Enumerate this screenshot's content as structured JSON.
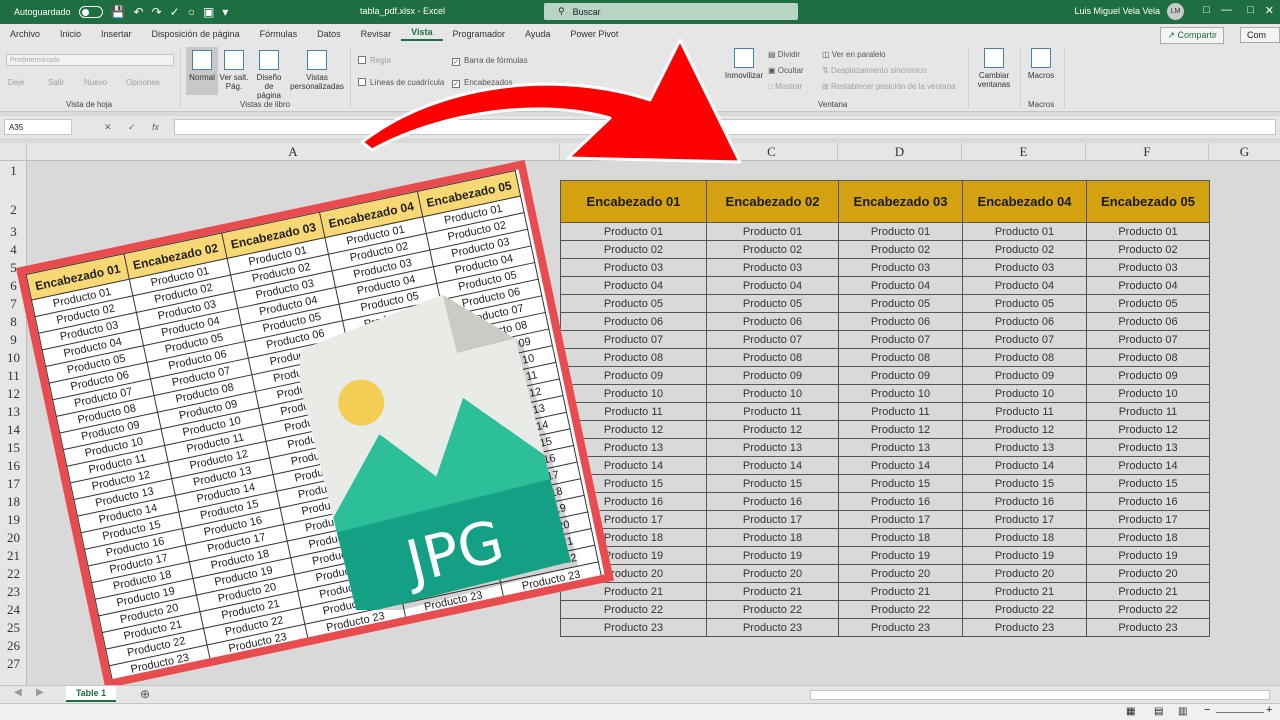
{
  "titlebar": {
    "autosave_label": "Autoguardado",
    "filename": "tabla_pdf.xlsx",
    "app": "Excel",
    "search_placeholder": "Buscar",
    "user_name": "Luis Miguel Vela Vela",
    "user_initials": "LM"
  },
  "menu": {
    "tabs": [
      "Archivo",
      "Inicio",
      "Insertar",
      "Disposición de página",
      "Fórmulas",
      "Datos",
      "Revisar",
      "Vista",
      "Programador",
      "Ayuda",
      "Power Pivot"
    ],
    "active_tab": "Vista",
    "share_label": "Compartir",
    "comments_label": "Com"
  },
  "ribbon": {
    "view_combo": "Predeterminado",
    "sheet_view_buttons": [
      "Deje",
      "Salir",
      "Nuevo",
      "Opciones"
    ],
    "group_sheet_view": "Vista de hoja",
    "btn_normal": "Normal",
    "btn_page_break": "Ver salt. Pág.",
    "btn_page_layout": "Diseño de página",
    "btn_custom_views": "Vistas personalizadas",
    "group_workbook_views": "Vistas de libro",
    "chk_ruler": "Regla",
    "chk_formula_bar": "Barra de fórmulas",
    "chk_gridlines": "Líneas de cuadrícula",
    "chk_headings": "Encabezados",
    "btn_freeze": "Inmovilizar",
    "btn_split": "Dividir",
    "btn_hide": "Ocultar",
    "btn_show": "Mostrar",
    "btn_side_by_side": "Ver en paralelo",
    "btn_sync_scroll": "Desplazamiento sincrónico",
    "btn_reset_position": "Restablecer posición de la ventana",
    "btn_switch_windows": "Cambiar ventanas",
    "group_window": "Ventana",
    "btn_macros": "Macros",
    "group_macros": "Macros"
  },
  "formula_bar": {
    "name_box": "A35",
    "fx": "fx"
  },
  "columns": [
    "A",
    "C",
    "D",
    "E",
    "F",
    "G"
  ],
  "rows": [
    "1",
    "2",
    "3",
    "4",
    "5",
    "6",
    "7",
    "8",
    "9",
    "10",
    "11",
    "12",
    "13",
    "14",
    "15",
    "16",
    "17",
    "18",
    "19",
    "20",
    "21",
    "22",
    "23",
    "24",
    "25",
    "26",
    "27"
  ],
  "table": {
    "headers": [
      "Encabezado 01",
      "Encabezado 02",
      "Encabezado 03",
      "Encabezado 04",
      "Encabezado 05"
    ],
    "rows": [
      "Producto 01",
      "Producto 02",
      "Producto 03",
      "Producto 04",
      "Producto 05",
      "Producto 06",
      "Producto 07",
      "Producto 08",
      "Producto 09",
      "Producto 10",
      "Producto 11",
      "Producto 12",
      "Producto 13",
      "Producto 14",
      "Producto 15",
      "Producto 16",
      "Producto 17",
      "Producto 18",
      "Producto 19",
      "Producto 20",
      "Producto 21",
      "Producto 22",
      "Producto 23"
    ]
  },
  "jpg_label": "JPG",
  "sheet_tab": "Table 1",
  "colors": {
    "excel_green": "#1e6e41",
    "header_gold": "#d4a210",
    "frame_red": "#e84c4f",
    "arrow_red": "#ff0000",
    "jpg_teal": "#13a085",
    "mountain_teal": "#2dbe9a",
    "sun_yellow": "#f4ce54"
  }
}
